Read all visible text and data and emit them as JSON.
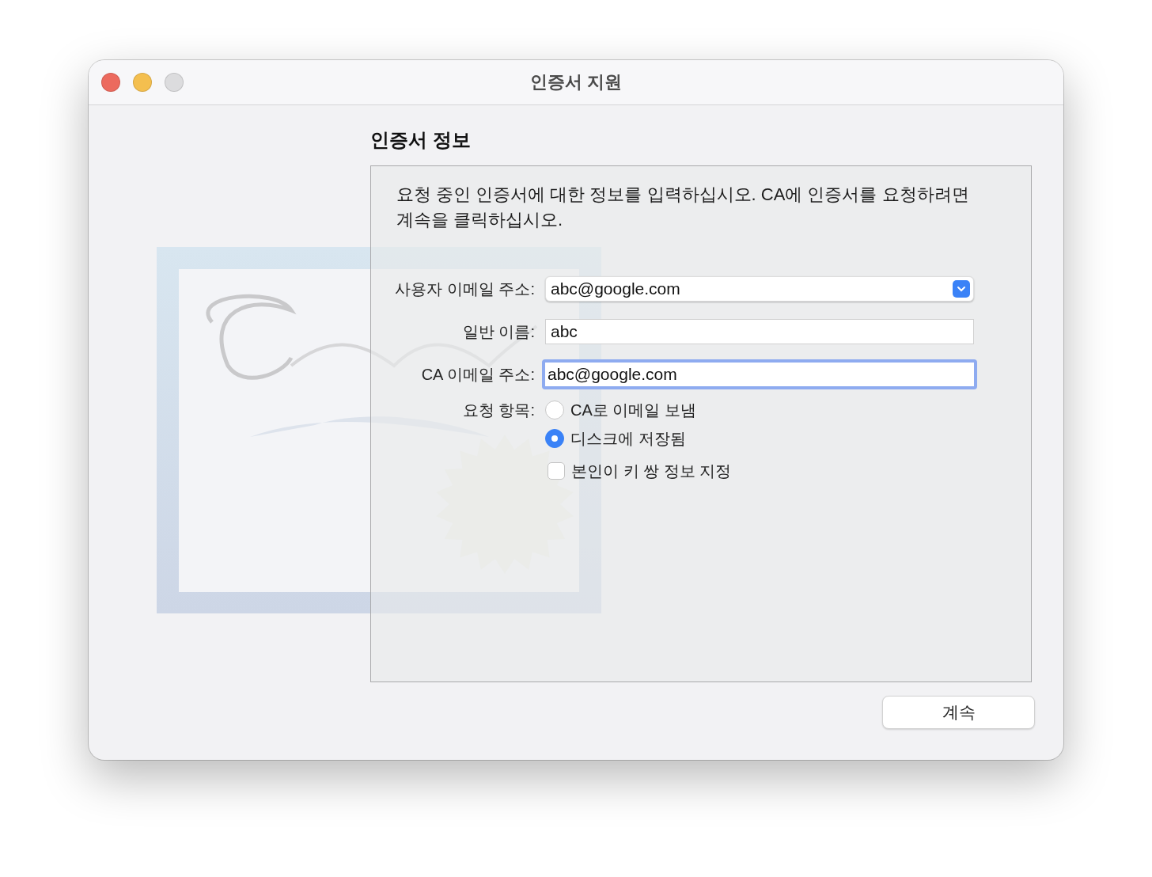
{
  "window": {
    "title": "인증서 지원"
  },
  "heading": "인증서 정보",
  "description": "요청 중인 인증서에 대한 정보를 입력하십시오. CA에 인증서를 요청하려면 계속을 클릭하십시오.",
  "fields": [
    {
      "kind": "dropdown",
      "label": "사용자 이메일 주소:",
      "value": "abc@google.com",
      "focused": false
    },
    {
      "kind": "text",
      "label": "일반 이름:",
      "value": "abc",
      "focused": false
    },
    {
      "kind": "text",
      "label": "CA 이메일 주소:",
      "value": "abc@google.com",
      "focused": true
    }
  ],
  "request": {
    "label": "요청 항목:",
    "options": [
      {
        "label": "CA로 이메일 보냄",
        "selected": false
      },
      {
        "label": "디스크에 저장됨",
        "selected": true
      }
    ]
  },
  "key_pair_checkbox": {
    "label": "본인이 키 쌍 정보 지정",
    "checked": false
  },
  "buttons": [
    {
      "label": "계속"
    }
  ]
}
